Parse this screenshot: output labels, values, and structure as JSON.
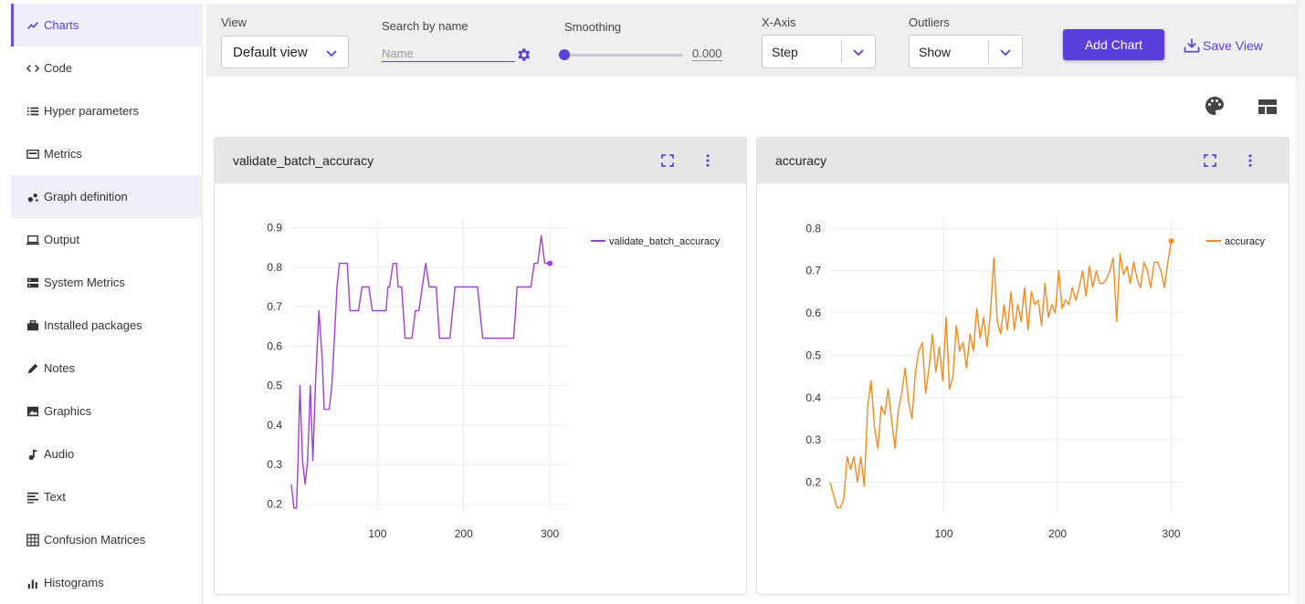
{
  "sidebar": {
    "items": [
      {
        "label": "Charts",
        "icon": "chart-line-icon",
        "state": "active"
      },
      {
        "label": "Code",
        "icon": "code-icon",
        "state": ""
      },
      {
        "label": "Hyper parameters",
        "icon": "list-icon",
        "state": ""
      },
      {
        "label": "Metrics",
        "icon": "metrics-icon",
        "state": ""
      },
      {
        "label": "Graph definition",
        "icon": "graph-icon",
        "state": "hover"
      },
      {
        "label": "Output",
        "icon": "laptop-icon",
        "state": ""
      },
      {
        "label": "System Metrics",
        "icon": "server-icon",
        "state": ""
      },
      {
        "label": "Installed packages",
        "icon": "briefcase-icon",
        "state": ""
      },
      {
        "label": "Notes",
        "icon": "pencil-icon",
        "state": ""
      },
      {
        "label": "Graphics",
        "icon": "image-icon",
        "state": ""
      },
      {
        "label": "Audio",
        "icon": "music-note-icon",
        "state": ""
      },
      {
        "label": "Text",
        "icon": "text-icon",
        "state": ""
      },
      {
        "label": "Confusion Matrices",
        "icon": "grid-icon",
        "state": ""
      },
      {
        "label": "Histograms",
        "icon": "bar-chart-icon",
        "state": ""
      }
    ]
  },
  "toolbar": {
    "view_label": "View",
    "view_value": "Default view",
    "search_label": "Search by name",
    "search_placeholder": "Name",
    "smoothing_label": "Smoothing",
    "smoothing_value": "0.000",
    "smoothing_fraction": 0,
    "xaxis_label": "X-Axis",
    "xaxis_value": "Step",
    "outliers_label": "Outliers",
    "outliers_value": "Show",
    "add_chart_label": "Add Chart",
    "save_view_label": "Save View"
  },
  "colors": {
    "accent": "#5b3fdc",
    "series_purple": "#a03fd0",
    "series_orange": "#f28a1e"
  },
  "chart_data": [
    {
      "type": "line",
      "title": "validate_batch_accuracy",
      "xlim": [
        0,
        320
      ],
      "ylim": [
        0.18,
        0.92
      ],
      "xticks": [
        100,
        200,
        300
      ],
      "yticks": [
        0.2,
        0.3,
        0.4,
        0.5,
        0.6,
        0.7,
        0.8,
        0.9
      ],
      "grid": true,
      "legend": "top-right",
      "series": [
        {
          "name": "validate_batch_accuracy",
          "x": [
            0,
            3,
            6,
            8,
            10,
            13,
            16,
            19,
            22,
            25,
            28,
            32,
            36,
            38,
            40,
            44,
            47,
            50,
            53,
            56,
            59,
            62,
            65,
            68,
            70,
            74,
            78,
            82,
            86,
            90,
            94,
            98,
            102,
            106,
            110,
            112,
            114,
            118,
            122,
            124,
            128,
            132,
            136,
            140,
            144,
            148,
            152,
            156,
            160,
            164,
            168,
            172,
            176,
            180,
            184,
            190,
            196,
            200,
            206,
            212,
            216,
            222,
            228,
            234,
            240,
            246,
            252,
            258,
            262,
            266,
            270,
            274,
            278,
            282,
            286,
            290,
            294,
            298,
            300
          ],
          "y": [
            0.25,
            0.19,
            0.19,
            0.32,
            0.5,
            0.31,
            0.25,
            0.31,
            0.5,
            0.31,
            0.5,
            0.69,
            0.56,
            0.44,
            0.44,
            0.44,
            0.5,
            0.62,
            0.75,
            0.81,
            0.81,
            0.81,
            0.81,
            0.69,
            0.69,
            0.69,
            0.69,
            0.75,
            0.75,
            0.75,
            0.69,
            0.69,
            0.69,
            0.69,
            0.69,
            0.75,
            0.75,
            0.81,
            0.81,
            0.75,
            0.75,
            0.62,
            0.62,
            0.62,
            0.69,
            0.69,
            0.75,
            0.81,
            0.75,
            0.75,
            0.75,
            0.62,
            0.62,
            0.62,
            0.62,
            0.75,
            0.75,
            0.75,
            0.75,
            0.75,
            0.75,
            0.62,
            0.62,
            0.62,
            0.62,
            0.62,
            0.62,
            0.62,
            0.75,
            0.75,
            0.75,
            0.75,
            0.75,
            0.81,
            0.81,
            0.88,
            0.81,
            0.81,
            0.81
          ],
          "color": "#a03fd0",
          "last_marker": true
        }
      ]
    },
    {
      "type": "line",
      "title": "accuracy",
      "xlim": [
        0,
        310
      ],
      "ylim": [
        0.13,
        0.82
      ],
      "xticks": [
        100,
        200,
        300
      ],
      "yticks": [
        0.2,
        0.3,
        0.4,
        0.5,
        0.6,
        0.7,
        0.8
      ],
      "grid": true,
      "legend": "top-right",
      "series": [
        {
          "name": "accuracy",
          "x": [
            0,
            3,
            6,
            9,
            12,
            15,
            18,
            21,
            24,
            27,
            30,
            33,
            36,
            39,
            42,
            45,
            48,
            51,
            54,
            57,
            60,
            63,
            66,
            69,
            72,
            75,
            78,
            81,
            84,
            87,
            90,
            93,
            96,
            99,
            102,
            105,
            108,
            111,
            114,
            117,
            120,
            123,
            126,
            129,
            132,
            135,
            138,
            141,
            144,
            147,
            150,
            153,
            156,
            159,
            162,
            165,
            168,
            171,
            174,
            177,
            180,
            183,
            186,
            189,
            192,
            195,
            198,
            201,
            204,
            207,
            210,
            213,
            216,
            219,
            222,
            225,
            228,
            231,
            234,
            237,
            240,
            243,
            246,
            249,
            252,
            255,
            258,
            261,
            264,
            267,
            270,
            273,
            276,
            279,
            282,
            285,
            288,
            291,
            294,
            297,
            300
          ],
          "y": [
            0.2,
            0.17,
            0.14,
            0.14,
            0.16,
            0.26,
            0.23,
            0.26,
            0.2,
            0.26,
            0.19,
            0.38,
            0.44,
            0.33,
            0.28,
            0.38,
            0.36,
            0.42,
            0.35,
            0.28,
            0.37,
            0.41,
            0.47,
            0.39,
            0.35,
            0.46,
            0.51,
            0.53,
            0.41,
            0.47,
            0.55,
            0.46,
            0.52,
            0.44,
            0.59,
            0.42,
            0.45,
            0.57,
            0.51,
            0.53,
            0.47,
            0.55,
            0.51,
            0.61,
            0.54,
            0.59,
            0.52,
            0.6,
            0.73,
            0.58,
            0.55,
            0.62,
            0.56,
            0.65,
            0.56,
            0.62,
            0.58,
            0.66,
            0.56,
            0.65,
            0.62,
            0.63,
            0.57,
            0.67,
            0.59,
            0.62,
            0.6,
            0.7,
            0.61,
            0.63,
            0.62,
            0.66,
            0.63,
            0.66,
            0.7,
            0.64,
            0.71,
            0.66,
            0.7,
            0.67,
            0.67,
            0.68,
            0.7,
            0.73,
            0.58,
            0.74,
            0.69,
            0.71,
            0.67,
            0.72,
            0.68,
            0.66,
            0.72,
            0.7,
            0.66,
            0.72,
            0.72,
            0.7,
            0.66,
            0.72,
            0.77
          ],
          "color": "#f28a1e",
          "last_marker": true
        }
      ]
    }
  ]
}
